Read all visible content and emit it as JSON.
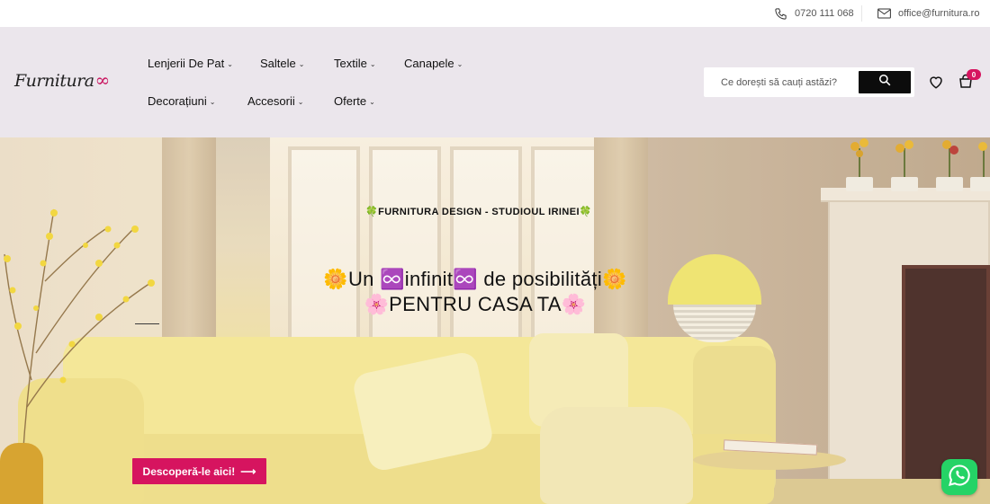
{
  "topbar": {
    "phone": "0720 111 068",
    "email": "office@furnitura.ro"
  },
  "header": {
    "logo_text": "Furnitura",
    "logo_symbol": "∞",
    "nav": [
      {
        "label": "Lenjerii De Pat"
      },
      {
        "label": "Saltele"
      },
      {
        "label": "Textile"
      },
      {
        "label": "Canapele"
      },
      {
        "label": "Decorațiuni"
      },
      {
        "label": "Accesorii"
      },
      {
        "label": "Oferte"
      }
    ],
    "search": {
      "placeholder": "Ce dorești să cauți astăzi?"
    },
    "cart_count": "0"
  },
  "hero": {
    "eyebrow": "🍀FURNITURA DESIGN - STUDIOUL IRINEI🍀",
    "title_line1": "🌼Un ♾️infinit♾️ de posibilități🌼",
    "title_line2": "🌸PENTRU CASA TA🌸",
    "cta_label": "Descoperă-le aici!",
    "cta_arrow": "⟶"
  },
  "colors": {
    "accent": "#d6145f",
    "header_bg": "#ebe6ec",
    "whatsapp": "#25d366"
  },
  "icons": [
    "phone-icon",
    "mail-icon",
    "search-icon",
    "heart-icon",
    "cart-icon",
    "whatsapp-icon",
    "chevron-down-icon"
  ]
}
